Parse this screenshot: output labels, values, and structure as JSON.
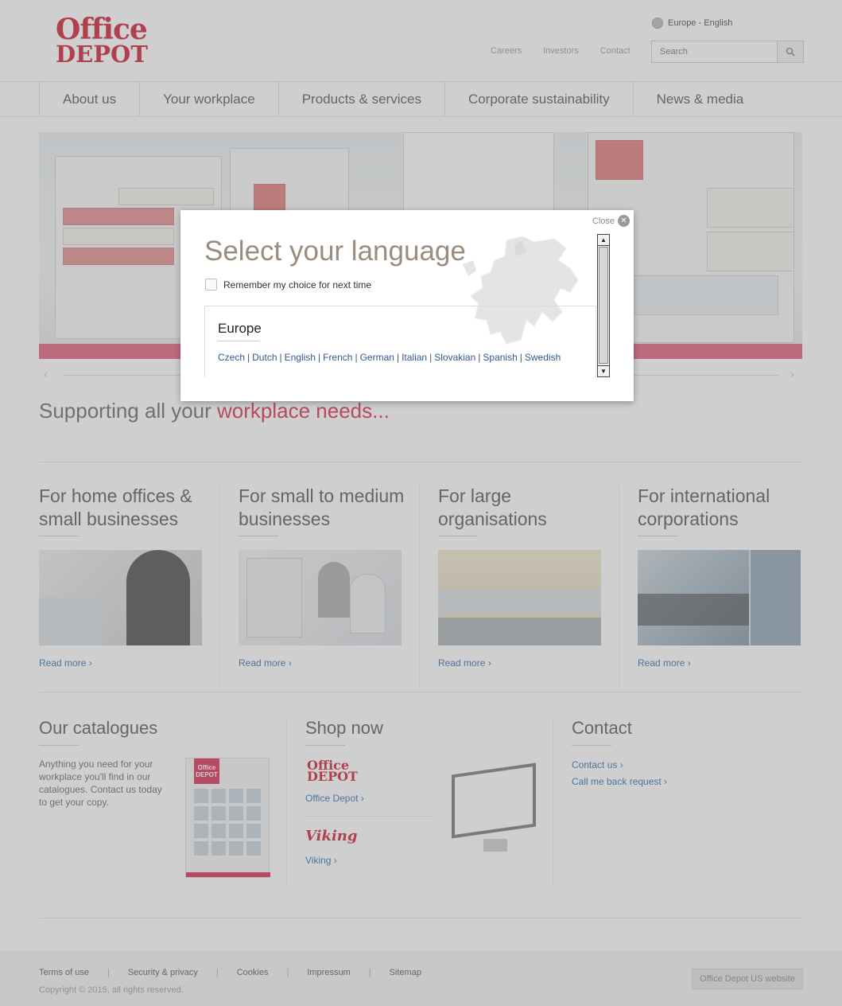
{
  "header": {
    "logo_line1": "Office",
    "logo_line2": "DEPOT",
    "region_label": "Europe - English",
    "top_links": [
      "Careers",
      "Investors",
      "Contact"
    ],
    "search_placeholder": "Search"
  },
  "nav": {
    "items": [
      "About us",
      "Your workplace",
      "Products & services",
      "Corporate sustainability",
      "News & media"
    ]
  },
  "hero": {
    "tagline_plain": "Supporting all your ",
    "tagline_accent": "workplace needs..."
  },
  "segments": [
    {
      "title": "For home offices & small businesses",
      "link": "Read more"
    },
    {
      "title": "For small to medium businesses",
      "link": "Read more"
    },
    {
      "title": "For large organisations",
      "link": "Read more"
    },
    {
      "title": "For international corporations",
      "link": "Read more"
    }
  ],
  "catalogues": {
    "title": "Our catalogues",
    "text": "Anything you need for your workplace you'll find in our catalogues. Contact us today to get your copy.",
    "cover_brand": "Office DEPOT"
  },
  "shop": {
    "title": "Shop now",
    "brand1_logo": "Office DEPOT",
    "brand1_link": "Office Depot",
    "brand2_logo": "Viking",
    "brand2_link": "Viking"
  },
  "contact": {
    "title": "Contact",
    "links": [
      "Contact us",
      "Call me back request"
    ]
  },
  "footer": {
    "links": [
      "Terms of use",
      "Security & privacy",
      "Cookies",
      "Impressum",
      "Sitemap"
    ],
    "copyright": "Copyright © 2015, all rights reserved.",
    "us_button": "Office Depot US website"
  },
  "modal": {
    "close_label": "Close",
    "title": "Select your language",
    "remember_label": "Remember my choice for next time",
    "region_name": "Europe",
    "languages": [
      "Czech",
      "Dutch",
      "English",
      "French",
      "German",
      "Italian",
      "Slovakian",
      "Spanish",
      "Swedish"
    ]
  },
  "colors": {
    "brand_red": "#cc1a30",
    "accent_pink": "#d8274e",
    "link_blue": "#2b6cb0",
    "title_taupe": "#9a8c7e",
    "overlay": "rgba(130,130,130,0.38)"
  }
}
